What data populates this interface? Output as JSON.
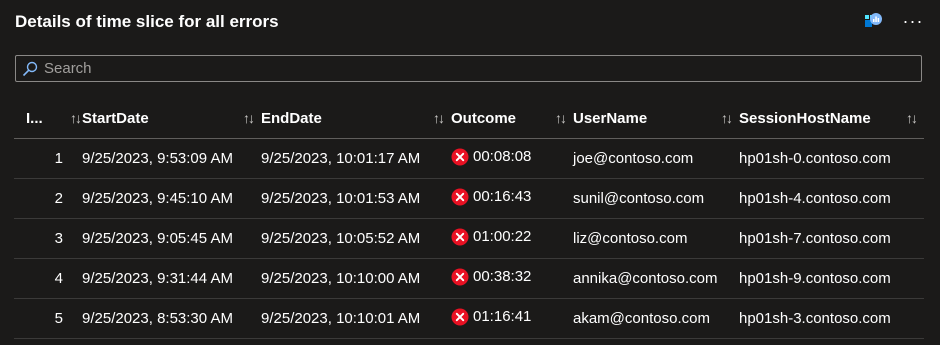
{
  "header": {
    "title": "Details of time slice for all errors"
  },
  "icons": {
    "pin": "pin-to-dashboard-icon",
    "more": "more-options-icon",
    "search": "search-icon",
    "error": "error-icon",
    "sort": "sort-icon"
  },
  "search": {
    "placeholder": "Search",
    "value": ""
  },
  "table": {
    "columns": [
      "I...",
      "StartDate",
      "EndDate",
      "Outcome",
      "UserName",
      "SessionHostName"
    ],
    "sort_glyph": "↑↓",
    "more_glyph": "···",
    "rows": [
      {
        "index": "1",
        "start": "9/25/2023, 9:53:09 AM",
        "end": "9/25/2023, 10:01:17 AM",
        "outcome": "00:08:08",
        "user": "joe@contoso.com",
        "host": "hp01sh-0.contoso.com"
      },
      {
        "index": "2",
        "start": "9/25/2023, 9:45:10 AM",
        "end": "9/25/2023, 10:01:53 AM",
        "outcome": "00:16:43",
        "user": "sunil@contoso.com",
        "host": "hp01sh-4.contoso.com"
      },
      {
        "index": "3",
        "start": "9/25/2023, 9:05:45 AM",
        "end": "9/25/2023, 10:05:52 AM",
        "outcome": "01:00:22",
        "user": "liz@contoso.com",
        "host": "hp01sh-7.contoso.com"
      },
      {
        "index": "4",
        "start": "9/25/2023, 9:31:44 AM",
        "end": "9/25/2023, 10:10:00 AM",
        "outcome": "00:38:32",
        "user": "annika@contoso.com",
        "host": "hp01sh-9.contoso.com"
      },
      {
        "index": "5",
        "start": "9/25/2023, 8:53:30 AM",
        "end": "9/25/2023, 10:10:01 AM",
        "outcome": "01:16:41",
        "user": "akam@contoso.com",
        "host": "hp01sh-3.contoso.com"
      }
    ]
  },
  "colors": {
    "background": "#1b1a19",
    "error": "#e81123",
    "accent": "#0078d4"
  }
}
